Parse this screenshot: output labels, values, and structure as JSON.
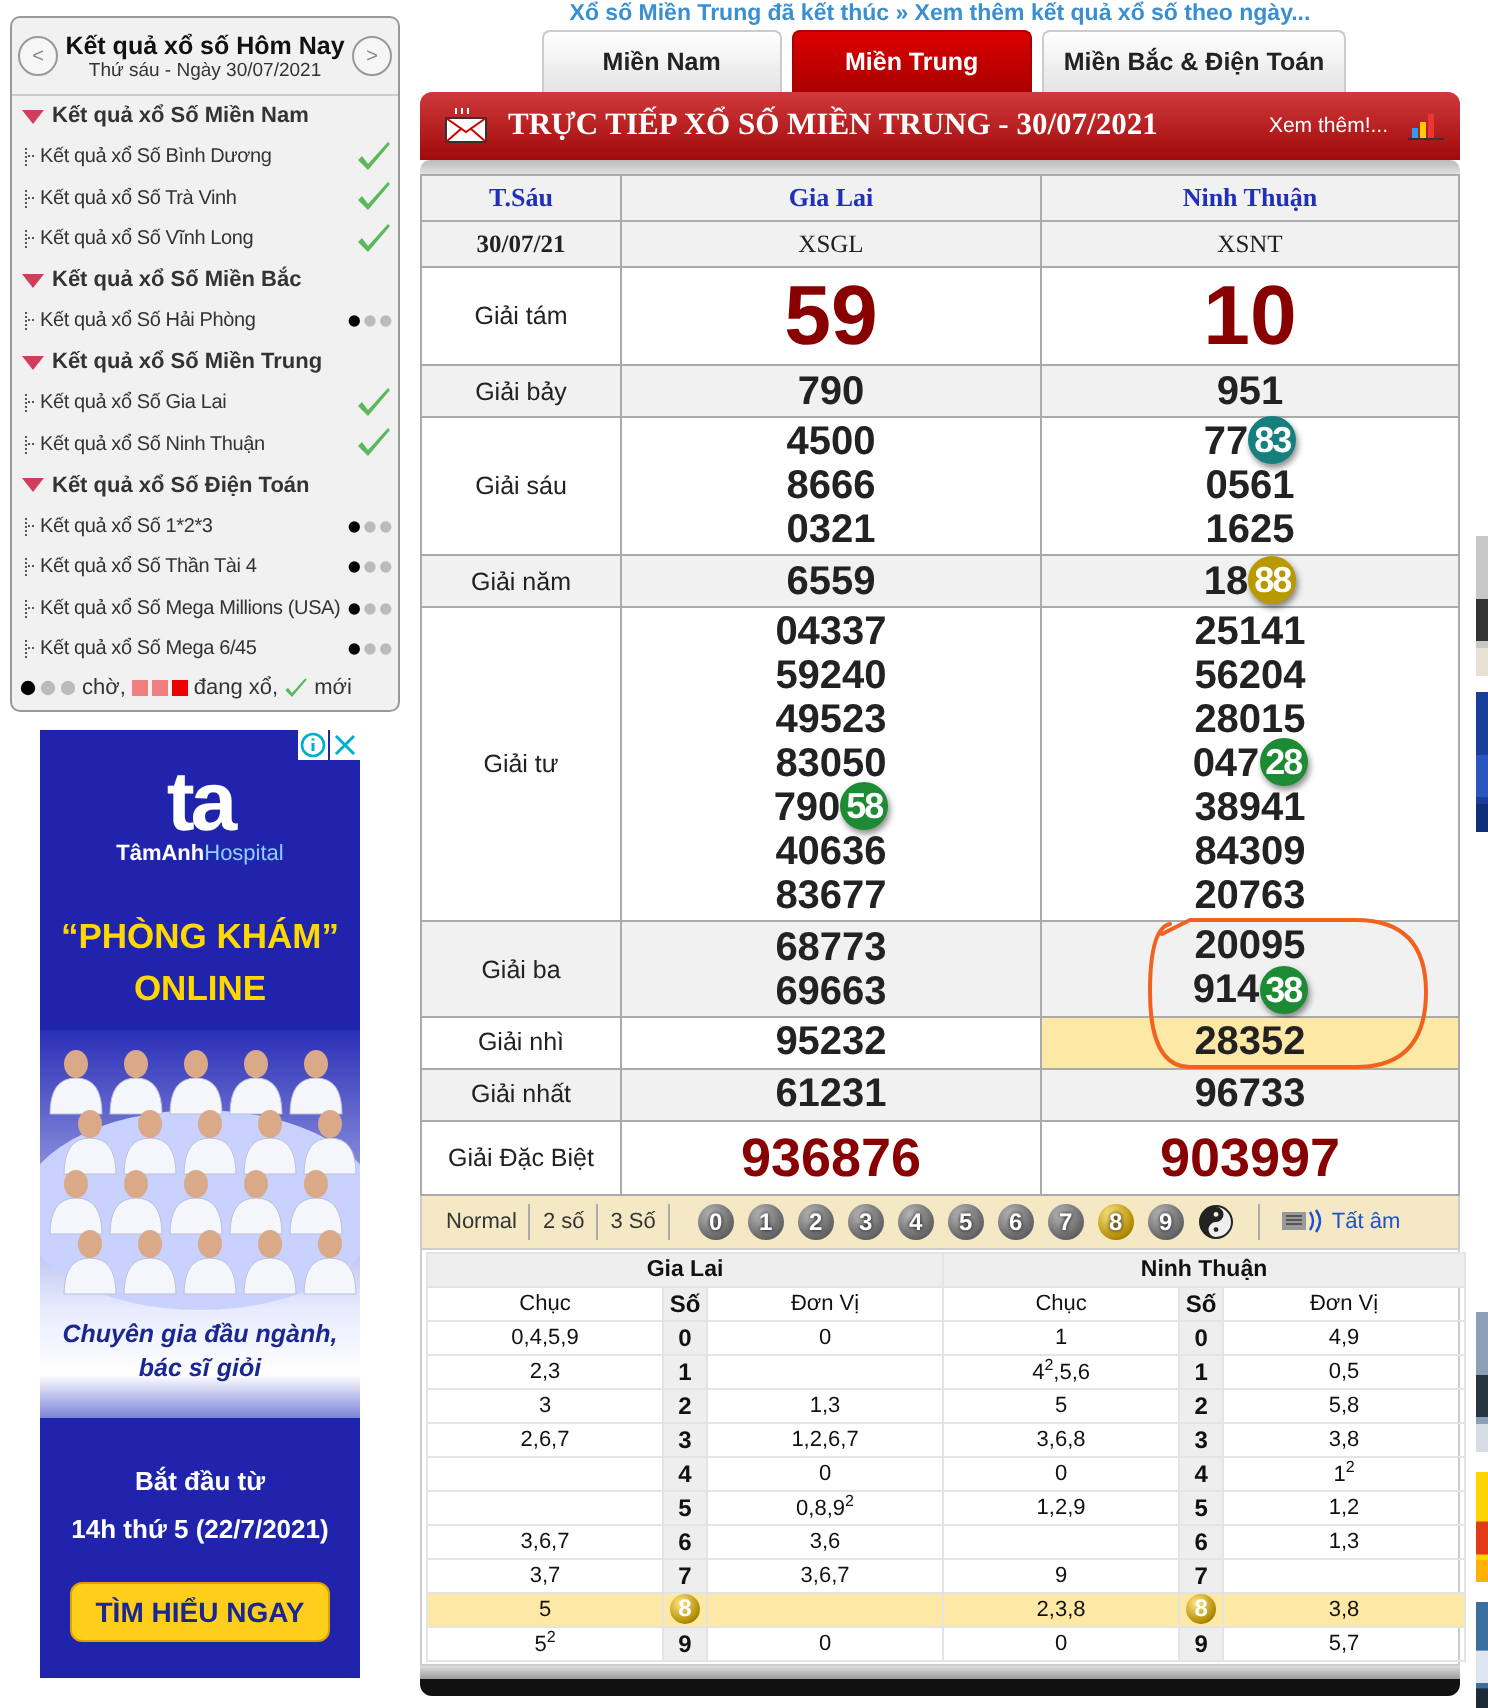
{
  "top_notice": "Xổ số Miền Trung đã kết thúc » Xem thêm kết quả xổ số theo ngày...",
  "sidebar": {
    "prev": "<",
    "next": ">",
    "title": "Kết quả xổ số Hôm Nay",
    "subtitle": "Thứ sáu - Ngày 30/07/2021",
    "groups": [
      {
        "title": "Kết quả xổ Số Miền Nam",
        "items": [
          {
            "label": "Kết quả xổ Số Bình Dương",
            "kind": "done"
          },
          {
            "label": "Kết quả xổ Số Trà Vinh",
            "kind": "done"
          },
          {
            "label": "Kết quả xổ Số Vĩnh Long",
            "kind": "done"
          }
        ]
      },
      {
        "title": "Kết quả xổ Số Miền Bắc",
        "items": [
          {
            "label": "Kết quả xổ Số Hải Phòng",
            "kind": "waiting"
          }
        ]
      },
      {
        "title": "Kết quả xổ Số Miền Trung",
        "items": [
          {
            "label": "Kết quả xổ Số Gia Lai",
            "kind": "done"
          },
          {
            "label": "Kết quả xổ Số Ninh Thuận",
            "kind": "done"
          }
        ]
      },
      {
        "title": "Kết quả xổ Số Điện Toán",
        "items": [
          {
            "label": "Kết quả xổ Số 1*2*3",
            "kind": "waiting"
          },
          {
            "label": "Kết quả xổ Số Thần Tài 4",
            "kind": "waiting"
          },
          {
            "label": "Kết quả xổ Số Mega Millions (USA)",
            "kind": "waiting"
          },
          {
            "label": "Kết quả xổ Số Mega 6/45",
            "kind": "waiting"
          }
        ]
      }
    ],
    "legend": {
      "waiting": "chờ,",
      "drawing": "đang xổ,",
      "new": "mới"
    }
  },
  "ad": {
    "logo": "ta",
    "brand": "**TâmAnh**Hospital",
    "headline": [
      "“PHÒNG KHÁM”",
      "ONLINE"
    ],
    "tagline": [
      "Chuyên gia đầu ngành,",
      "bác sĩ giỏi"
    ],
    "schedule": [
      "Bắt đầu từ",
      "14h thứ 5 (22/7/2021)"
    ],
    "cta": "TÌM HIỂU NGAY"
  },
  "tabs": [
    {
      "label": "Miền Nam",
      "selected": false
    },
    {
      "label": "Miền Trung",
      "selected": true
    },
    {
      "label": "Miền Bắc & Điện Toán",
      "selected": false
    }
  ],
  "results": {
    "title": "TRỰC TIẾP XỔ SỐ MIỀN TRUNG - 30/07/2021",
    "more": "Xem thêm!...",
    "day": "T.Sáu",
    "date": "30/07/21",
    "provinces": [
      {
        "name": "Gia Lai",
        "code": "XSGL"
      },
      {
        "name": "Ninh Thuận",
        "code": "XSNT"
      }
    ],
    "prizes": [
      {
        "label": "Giải tám",
        "kind": "eighth",
        "cells": [
          {
            "highlighted": false,
            "numbers": [
              {
                "text": "59"
              }
            ]
          },
          {
            "highlighted": false,
            "numbers": [
              {
                "text": "10"
              }
            ]
          }
        ]
      },
      {
        "label": "Giải bảy",
        "kind": "normal",
        "cells": [
          {
            "highlighted": false,
            "numbers": [
              {
                "text": "790"
              }
            ]
          },
          {
            "highlighted": false,
            "numbers": [
              {
                "text": "951"
              }
            ]
          }
        ]
      },
      {
        "label": "Giải sáu",
        "kind": "normal",
        "cells": [
          {
            "highlighted": false,
            "numbers": [
              {
                "text": "4500"
              },
              {
                "text": "8666"
              },
              {
                "text": "0321"
              }
            ]
          },
          {
            "highlighted": false,
            "numbers": [
              {
                "text": "77",
                "ball": "83",
                "color": "#16807e"
              },
              {
                "text": "0561"
              },
              {
                "text": "1625"
              }
            ]
          }
        ]
      },
      {
        "label": "Giải năm",
        "kind": "normal",
        "cells": [
          {
            "highlighted": false,
            "numbers": [
              {
                "text": "6559"
              }
            ]
          },
          {
            "highlighted": false,
            "numbers": [
              {
                "text": "18",
                "ball": "88",
                "color": "#b89a00"
              }
            ]
          }
        ]
      },
      {
        "label": "Giải tư",
        "kind": "normal",
        "cells": [
          {
            "highlighted": false,
            "numbers": [
              {
                "text": "04337"
              },
              {
                "text": "59240"
              },
              {
                "text": "49523"
              },
              {
                "text": "83050"
              },
              {
                "text": "790",
                "ball": "58",
                "color": "#1d8a34"
              },
              {
                "text": "40636"
              },
              {
                "text": "83677"
              }
            ]
          },
          {
            "highlighted": false,
            "numbers": [
              {
                "text": "25141"
              },
              {
                "text": "56204"
              },
              {
                "text": "28015"
              },
              {
                "text": "047",
                "ball": "28",
                "color": "#1d8a34"
              },
              {
                "text": "38941"
              },
              {
                "text": "84309"
              },
              {
                "text": "20763"
              }
            ]
          }
        ]
      },
      {
        "label": "Giải ba",
        "kind": "normal",
        "cells": [
          {
            "highlighted": false,
            "numbers": [
              {
                "text": "68773"
              },
              {
                "text": "69663"
              }
            ]
          },
          {
            "highlighted": false,
            "numbers": [
              {
                "text": "20095"
              },
              {
                "text": "914",
                "ball": "38",
                "color": "#1d8a34"
              }
            ]
          }
        ]
      },
      {
        "label": "Giải nhì",
        "kind": "normal",
        "cells": [
          {
            "highlighted": false,
            "numbers": [
              {
                "text": "95232"
              }
            ]
          },
          {
            "highlighted": true,
            "numbers": [
              {
                "text": "28352"
              }
            ]
          }
        ]
      },
      {
        "label": "Giải nhất",
        "kind": "normal",
        "cells": [
          {
            "highlighted": false,
            "numbers": [
              {
                "text": "61231"
              }
            ]
          },
          {
            "highlighted": false,
            "numbers": [
              {
                "text": "96733"
              }
            ]
          }
        ]
      },
      {
        "label": "Giải Đặc Biệt",
        "kind": "special",
        "cells": [
          {
            "highlighted": false,
            "numbers": [
              {
                "text": "936876"
              }
            ]
          },
          {
            "highlighted": false,
            "numbers": [
              {
                "text": "903997"
              }
            ]
          }
        ]
      }
    ]
  },
  "toolbar": {
    "modes": [
      {
        "label": "Normal"
      },
      {
        "label": "2 số"
      },
      {
        "label": "3 Số"
      }
    ],
    "digits": [
      {
        "label": "0",
        "selected": false
      },
      {
        "label": "1",
        "selected": false
      },
      {
        "label": "2",
        "selected": false
      },
      {
        "label": "3",
        "selected": false
      },
      {
        "label": "4",
        "selected": false
      },
      {
        "label": "5",
        "selected": false
      },
      {
        "label": "6",
        "selected": false
      },
      {
        "label": "7",
        "selected": false
      },
      {
        "label": "8",
        "selected": true
      },
      {
        "label": "9",
        "selected": false
      }
    ],
    "mute": "Tất âm"
  },
  "loto": {
    "sections": [
      {
        "name": "Gia Lai",
        "headers": [
          "Chục",
          "Số",
          "Đơn Vị"
        ],
        "rows": [
          {
            "tens": "0,4,5,9",
            "digit": "0",
            "units": "0",
            "selected": false
          },
          {
            "tens": "2,3",
            "digit": "1",
            "selected": false
          },
          {
            "tens": "3",
            "digit": "2",
            "units": "1,3",
            "selected": false
          },
          {
            "tens": "2,6,7",
            "digit": "3",
            "units": "1,2,6,7",
            "selected": false
          },
          {
            "digit": "4",
            "units": "0",
            "selected": false
          },
          {
            "digit": "5",
            "units": "0,8,9$^{2}$",
            "selected": false
          },
          {
            "tens": "3,6,7",
            "digit": "6",
            "units": "3,6",
            "selected": false
          },
          {
            "tens": "3,7",
            "digit": "7",
            "units": "3,6,7",
            "selected": false
          },
          {
            "tens": "5",
            "digit": "8",
            "selected": true
          },
          {
            "tens": "5$^{2}$",
            "digit": "9",
            "units": "0",
            "selected": false
          }
        ]
      },
      {
        "name": "Ninh Thuận",
        "headers": [
          "Chục",
          "Số",
          "Đơn Vị"
        ],
        "rows": [
          {
            "tens": "1",
            "digit": "0",
            "units": "4,9",
            "selected": false
          },
          {
            "tens": "4$^{2}$,5,6",
            "digit": "1",
            "units": "0,5",
            "selected": false
          },
          {
            "tens": "5",
            "digit": "2",
            "units": "5,8",
            "selected": false
          },
          {
            "tens": "3,6,8",
            "digit": "3",
            "units": "3,8",
            "selected": false
          },
          {
            "tens": "0",
            "digit": "4",
            "units": "1$^{2}$",
            "selected": false
          },
          {
            "tens": "1,2,9",
            "digit": "5",
            "units": "1,2",
            "selected": false
          },
          {
            "digit": "6",
            "units": "1,3",
            "selected": false
          },
          {
            "tens": "9",
            "digit": "7",
            "selected": false
          },
          {
            "tens": "2,3,8",
            "digit": "8",
            "units": "3,8",
            "selected": true
          },
          {
            "tens": "0",
            "digit": "9",
            "units": "5,7",
            "selected": false
          }
        ]
      }
    ]
  }
}
